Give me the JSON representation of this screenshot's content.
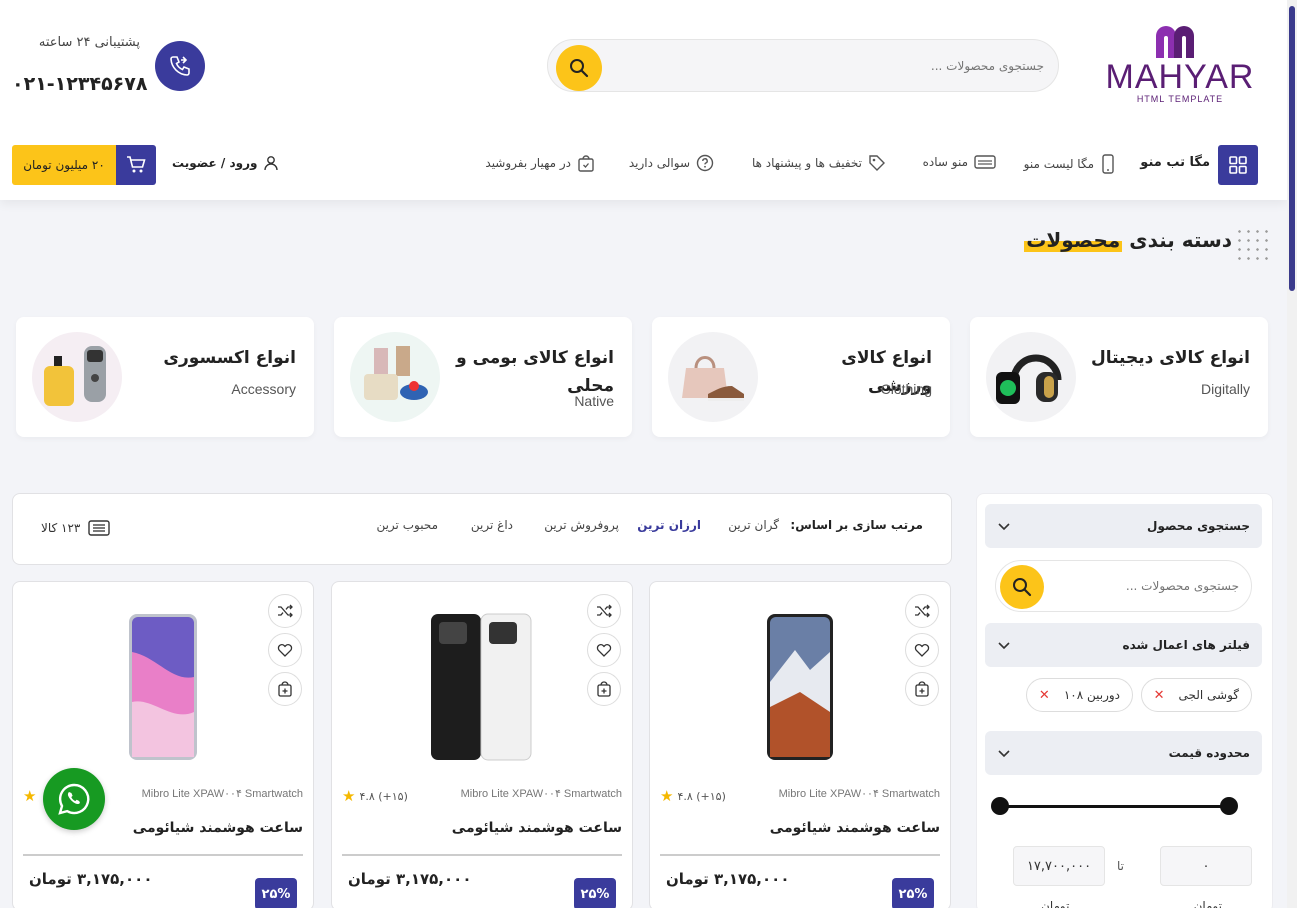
{
  "header": {
    "logo": {
      "brand": "MAHYAR",
      "subtitle": "HTML TEMPLATE"
    },
    "search": {
      "placeholder": "جستجوی محصولات ..."
    },
    "support": {
      "label": "پشتیبانی ۲۴ ساعته",
      "phone": "۰۲۱-۱۲۳۴۵۶۷۸"
    },
    "nav": {
      "mega_tab": "مگا تب منو",
      "mega_list": "مگا لیست منو",
      "simple_menu": "منو ساده",
      "offers": "تخفیف ها و پیشنهاد ها",
      "faq": "سوالی دارید",
      "sell": "در مهیار بفروشید"
    },
    "login": "ورود / عضویت",
    "cart_amount": "۲۰ میلیون تومان"
  },
  "section": {
    "title_part1": "دسته بندی",
    "title_part2": "محصولات"
  },
  "categories": [
    {
      "title": "انواع کالای دیجیتال",
      "subtitle": "Digitally"
    },
    {
      "title": "انواع کالای ورزشی",
      "subtitle": "Clothing"
    },
    {
      "title": "انواع کالای بومی و محلی",
      "subtitle": "Native"
    },
    {
      "title": "انواع اکسسوری",
      "subtitle": "Accessory"
    }
  ],
  "sort": {
    "label": "مرتب سازی بر اساس:",
    "options": [
      "گران ترین",
      "ارزان ترین",
      "پروفروش ترین",
      "داغ ترین",
      "محبوب ترین"
    ],
    "active_index": 1,
    "count": "۱۲۳ کالا"
  },
  "products": [
    {
      "model": "Mibro Lite XPAW۰۰۴ Smartwatch",
      "rating": "۴.۸ (+۱۵)",
      "title": "ساعت هوشمند شیائومی",
      "price": "۳,۱۷۵,۰۰۰ تومان",
      "discount": "۲۵%"
    },
    {
      "model": "Mibro Lite XPAW۰۰۴ Smartwatch",
      "rating": "۴.۸ (+۱۵)",
      "title": "ساعت هوشمند شیائومی",
      "price": "۳,۱۷۵,۰۰۰ تومان",
      "discount": "۲۵%"
    },
    {
      "model": "Mibro Lite XPAW۰۰۴ Smartwatch",
      "rating": "",
      "title": "ساعت هوشمند شیائومی",
      "price": "۳,۱۷۵,۰۰۰ تومان",
      "discount": "۲۵%"
    }
  ],
  "sidebar": {
    "search_title": "جستجوی محصول",
    "search_placeholder": "جستجوی محصولات ...",
    "filters_title": "فیلتر های اعمال شده",
    "chips": [
      "گوشی الجی",
      "دوربین ۱۰۸"
    ],
    "price_title": "محدوده قیمت",
    "price_min": "۰",
    "price_max": "۱۷,۷۰۰,۰۰۰",
    "to_label": "تا",
    "currency": "تومان"
  },
  "colors": {
    "primary": "#3a3b9c",
    "accent": "#fcc419",
    "whatsapp": "#179a22"
  }
}
